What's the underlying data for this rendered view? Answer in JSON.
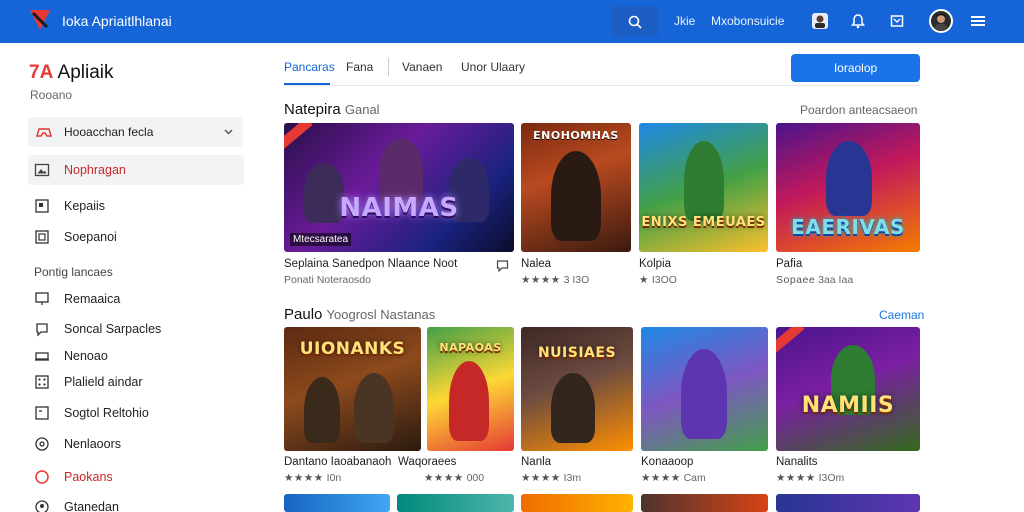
{
  "header": {
    "title": "Ioka Apriaitlhlanai",
    "links": [
      "Jkie",
      "Mxobonsuicie"
    ],
    "icons": [
      "search-icon",
      "profile-icon",
      "bell-icon",
      "flag-icon",
      "avatar",
      "menu-icon"
    ],
    "accent": "#1565d8"
  },
  "sidebar": {
    "brand_num": "7A",
    "brand_name": "Apliaik",
    "subtitle": "Rooano",
    "select_label": "Hooacchan fecla",
    "items": [
      {
        "label": "Nophragan",
        "icon": "image-icon",
        "active": true
      },
      {
        "label": "Kepaiis",
        "icon": "card-icon"
      },
      {
        "label": "Soepanoi",
        "icon": "box-icon"
      }
    ],
    "section_label": "Pontig lancaes",
    "sub_items": [
      {
        "label": "Remaaica",
        "icon": "monitor-icon"
      },
      {
        "label": "Soncal Sarpacles",
        "icon": "chat-icon"
      },
      {
        "label": "Nenoao",
        "icon": "laptop-icon"
      },
      {
        "label": "Plalield aindar",
        "icon": "dice-icon"
      },
      {
        "label": "Sogtol Reltohio",
        "icon": "document-icon"
      },
      {
        "label": "Nenlaoors",
        "icon": "settings-icon"
      },
      {
        "label": "Paokans",
        "icon": "circle-icon",
        "red": true
      },
      {
        "label": "Gtanedan",
        "icon": "user-icon"
      }
    ]
  },
  "tabs": [
    "Pancaras",
    "Fana",
    "Vanaen",
    "Unor Ulaary"
  ],
  "primary_button": "Ioraolop",
  "section1": {
    "title": "Natepira",
    "subtitle": "Ganal",
    "right_link": "Poardon anteacsaeon",
    "cards": [
      {
        "art": "NAIMAS",
        "caption": "Mtecsaratea",
        "title": "Seplaina Sanedpon Nlaance Noot",
        "meta": "Ponati Noteraosdo"
      },
      {
        "art": "ENOHOMHAS",
        "title": "Nalea",
        "stars": "★★★★",
        "meta": "3 I3O"
      },
      {
        "art": "ENIXS EMEUAES",
        "title": "Kolpia",
        "stars": "★",
        "meta": "I3OO"
      },
      {
        "art": "EAERIVAS",
        "title": "Pafia",
        "stars": "Sopaee",
        "meta": "3aa  Iaa"
      }
    ]
  },
  "section2": {
    "title": "Paulo",
    "subtitle": "Yoogrosl Nastanas",
    "right_link": "Caeman",
    "cards": [
      {
        "art": "UIONANKS",
        "title": "Dantano Iaoabanaoh",
        "stars": "★★★★",
        "meta": "I0n"
      },
      {
        "art": "NAPAOAS",
        "title": "Waqoraees",
        "stars": "★★★★",
        "meta": "000"
      },
      {
        "art": "NUISIAES",
        "title": "Nanla",
        "stars": "★★★★",
        "meta": "I3m"
      },
      {
        "art": "",
        "title": "Konaaoop",
        "stars": "★★★★",
        "meta": "Cam"
      },
      {
        "art": "NAMIIS",
        "title": "Nanalits",
        "stars": "★★★★",
        "meta": "I3Om"
      }
    ]
  }
}
